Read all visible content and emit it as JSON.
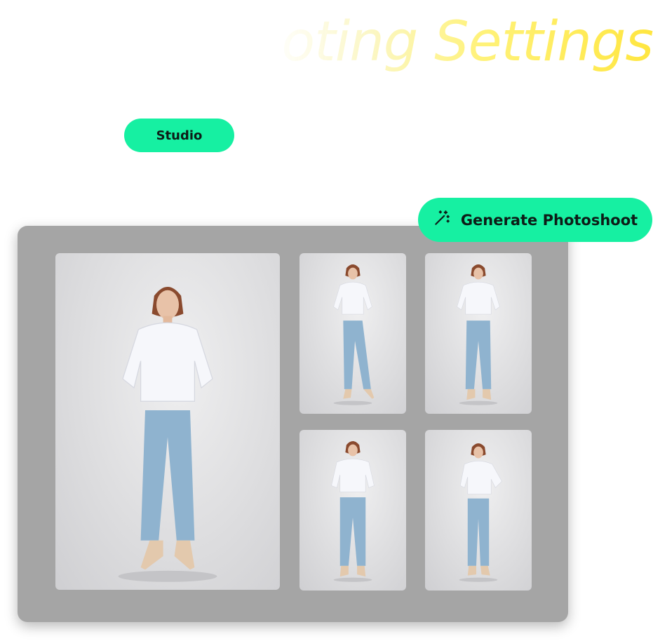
{
  "header": {
    "title": "oting Settings"
  },
  "tags": {
    "studio_label": "Studio"
  },
  "actions": {
    "generate_label": "Generate Photoshoot",
    "generate_icon": "magic-wand-icon"
  },
  "colors": {
    "accent": "#16f0a2",
    "panel_bg": "#a5a5a5",
    "title_gradient_end": "#ffe640"
  },
  "gallery": {
    "photos": [
      "main",
      "walking",
      "standing",
      "hands-in-pockets",
      "hand-on-hip"
    ]
  }
}
